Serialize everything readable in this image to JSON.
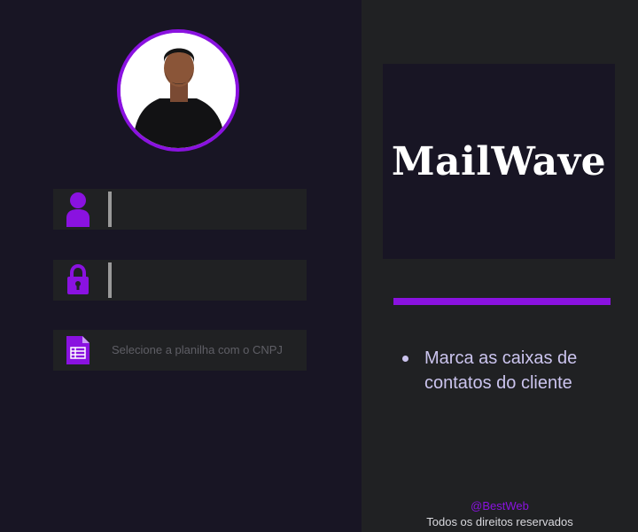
{
  "login": {
    "username": {
      "value": "",
      "icon": "user-icon"
    },
    "password": {
      "value": "",
      "icon": "lock-icon"
    },
    "spreadsheet": {
      "label": "Selecione a planilha com o CNPJ",
      "icon": "spreadsheet-icon"
    }
  },
  "brand": {
    "title": "MailWave",
    "features": [
      "Marca as caixas de contatos do cliente"
    ]
  },
  "footer": {
    "credit": "@BestWeb",
    "rights": "Todos os direitos reservados"
  },
  "colors": {
    "accent": "#8a12e0",
    "panel_dark": "#181524",
    "panel_field": "#202123",
    "text_light": "#cbc4ee"
  }
}
